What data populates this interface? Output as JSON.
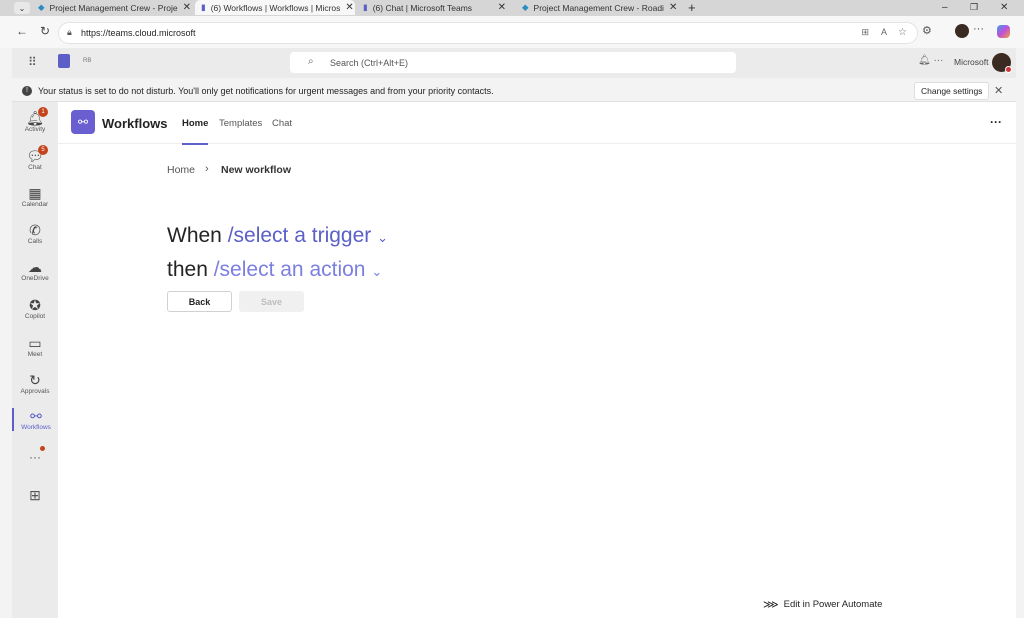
{
  "browser": {
    "tabs": [
      {
        "title": "Project Management Crew - Proje",
        "active": false
      },
      {
        "title": "(6) Workflows | Workflows | Micros",
        "active": true
      },
      {
        "title": "(6) Chat | Microsoft Teams",
        "active": false
      },
      {
        "title": "Project Management Crew - Roadi",
        "active": false
      }
    ],
    "url": "https://teams.cloud.microsoft"
  },
  "teams": {
    "initials": "RB",
    "search_placeholder": "Search (Ctrl+Alt+E)",
    "org": "Microsoft",
    "banner": "Your status is set to do not disturb. You'll only get notifications for urgent messages and from your priority contacts.",
    "change_settings": "Change settings"
  },
  "rail": [
    {
      "label": "Activity",
      "icon": "bell-icon",
      "badge": "1"
    },
    {
      "label": "Chat",
      "icon": "chat-icon",
      "badge": "5"
    },
    {
      "label": "Calendar",
      "icon": "calendar-icon"
    },
    {
      "label": "Calls",
      "icon": "phone-icon"
    },
    {
      "label": "OneDrive",
      "icon": "cloud-icon"
    },
    {
      "label": "Copilot",
      "icon": "copilot-icon"
    },
    {
      "label": "Meet",
      "icon": "video-icon"
    },
    {
      "label": "Approvals",
      "icon": "approvals-icon"
    },
    {
      "label": "Workflows",
      "icon": "workflows-icon"
    }
  ],
  "app": {
    "title": "Workflows",
    "tabs": [
      "Home",
      "Templates",
      "Chat"
    ],
    "breadcrumb": {
      "home": "Home",
      "current": "New workflow"
    },
    "when": "When",
    "trigger": "/select a trigger",
    "then": "then",
    "action": "/select an action",
    "back": "Back",
    "save": "Save",
    "edit_power_automate": "Edit in Power Automate"
  }
}
